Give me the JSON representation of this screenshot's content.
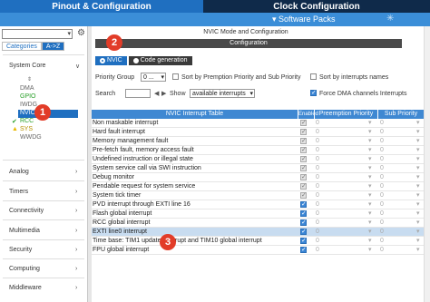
{
  "top_tabs": {
    "pinout": "Pinout & Configuration",
    "clock": "Clock Configuration"
  },
  "subbar": {
    "software_packs": "▾ Software Packs"
  },
  "left": {
    "search_value": "",
    "categories_tab": "Categories",
    "az_tab": "A->Z",
    "system_core": "System Core",
    "tree": [
      "DMA",
      "GPIO",
      "IWDG",
      "NVIC",
      "RCC",
      "SYS",
      "WWDG"
    ],
    "groups": [
      "Analog",
      "Timers",
      "Connectivity",
      "Multimedia",
      "Security",
      "Computing",
      "Middleware"
    ]
  },
  "main": {
    "mode_title": "NVIC Mode and Configuration",
    "configuration": "Configuration",
    "tab_nvic": "NVIC",
    "tab_codegen": "Code generation",
    "priority_group_label": "Priority Group",
    "priority_group_value": "0 ...",
    "sort_preemption": "Sort by Premption Priority and Sub Priority",
    "sort_interrupts": "Sort by interrupts names",
    "search_label": "Search",
    "show_label": "Show",
    "show_value": "available interrupts",
    "force_dma": "Force DMA channels Interrupts",
    "table": {
      "headers": [
        "NVIC Interrupt Table",
        "Enabled",
        "Preemption Priority",
        "Sub Priority"
      ],
      "rows": [
        {
          "name": "Non maskable interrupt",
          "pp": "0",
          "sp": "0"
        },
        {
          "name": "Hard fault interrupt",
          "pp": "0",
          "sp": "0"
        },
        {
          "name": "Memory management fault",
          "pp": "0",
          "sp": "0"
        },
        {
          "name": "Pre-fetch fault, memory access fault",
          "pp": "0",
          "sp": "0"
        },
        {
          "name": "Undefined instruction or illegal state",
          "pp": "0",
          "sp": "0"
        },
        {
          "name": "System service call via SWI instruction",
          "pp": "0",
          "sp": "0"
        },
        {
          "name": "Debug monitor",
          "pp": "0",
          "sp": "0"
        },
        {
          "name": "Pendable request for system service",
          "pp": "0",
          "sp": "0"
        },
        {
          "name": "System tick timer",
          "pp": "0",
          "sp": "0"
        },
        {
          "name": "PVD interrupt through EXTI line 16",
          "pp": "0",
          "sp": "0"
        },
        {
          "name": "Flash global interrupt",
          "pp": "0",
          "sp": "0"
        },
        {
          "name": "RCC global interrupt",
          "pp": "0",
          "sp": "0"
        },
        {
          "name": "EXTI line0 interrupt",
          "pp": "0",
          "sp": "0"
        },
        {
          "name": "Time base: TIM1 update interrupt and TIM10 global interrupt",
          "pp": "0",
          "sp": "0"
        },
        {
          "name": "FPU global interrupt",
          "pp": "0",
          "sp": "0"
        }
      ]
    }
  },
  "callouts": [
    "1",
    "2",
    "3"
  ],
  "colors": {
    "accent": "#1f6fc0",
    "callout": "#e23c28"
  }
}
